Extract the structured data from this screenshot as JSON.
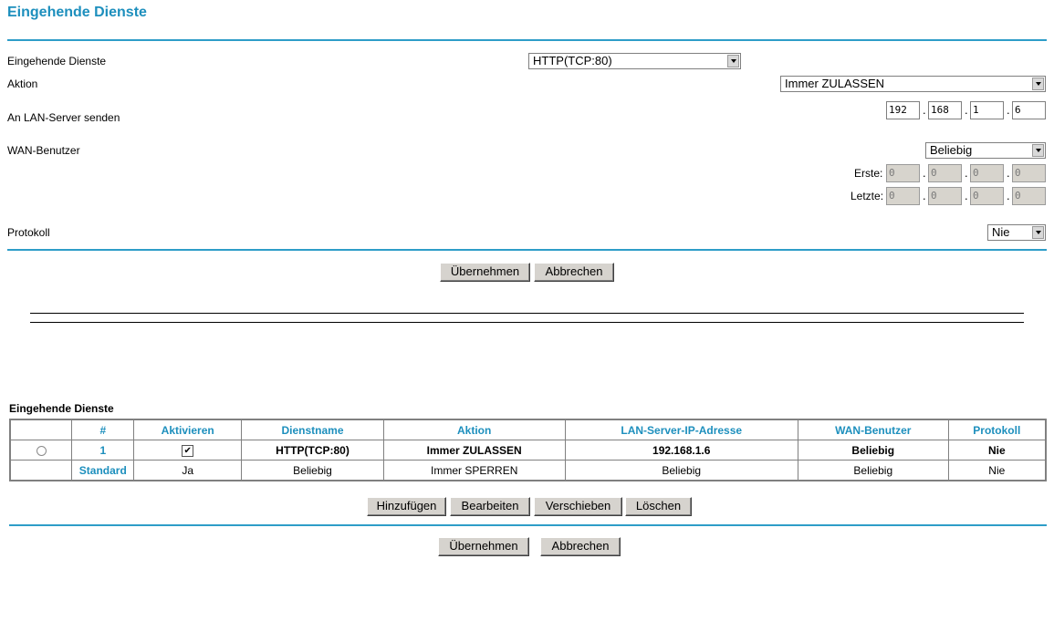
{
  "page_title": "Eingehende Dienste",
  "form": {
    "service_label": "Eingehende Dienste",
    "service_value": "HTTP(TCP:80)",
    "action_label": "Aktion",
    "action_value": "Immer ZULASSEN",
    "lan_label": "An LAN-Server senden",
    "lan_ip": [
      "192",
      "168",
      "1",
      "6"
    ],
    "wan_label": "WAN-Benutzer",
    "wan_value": "Beliebig",
    "first_label": "Erste:",
    "first_ip": [
      "0",
      "0",
      "0",
      "0"
    ],
    "last_label": "Letzte:",
    "last_ip": [
      "0",
      "0",
      "0",
      "0"
    ],
    "log_label": "Protokoll",
    "log_value": "Nie",
    "ip_separator": "."
  },
  "buttons": {
    "apply": "Übernehmen",
    "cancel": "Abbrechen",
    "add": "Hinzufügen",
    "edit": "Bearbeiten",
    "move": "Verschieben",
    "delete": "Löschen"
  },
  "table": {
    "title": "Eingehende Dienste",
    "headers": [
      "",
      "#",
      "Aktivieren",
      "Dienstname",
      "Aktion",
      "LAN-Server-IP-Adresse",
      "WAN-Benutzer",
      "Protokoll"
    ],
    "rows": [
      {
        "num": "1",
        "enabled": true,
        "service": "HTTP(TCP:80)",
        "action": "Immer ZULASSEN",
        "lan_ip": "192.168.1.6",
        "wan": "Beliebig",
        "log": "Nie"
      }
    ],
    "default_row": {
      "num": "Standard",
      "enabled": "Ja",
      "service": "Beliebig",
      "action": "Immer SPERREN",
      "lan_ip": "Beliebig",
      "wan": "Beliebig",
      "log": "Nie"
    }
  },
  "colors": {
    "accent": "#1d8fbd",
    "rule": "#2e9dc8"
  }
}
